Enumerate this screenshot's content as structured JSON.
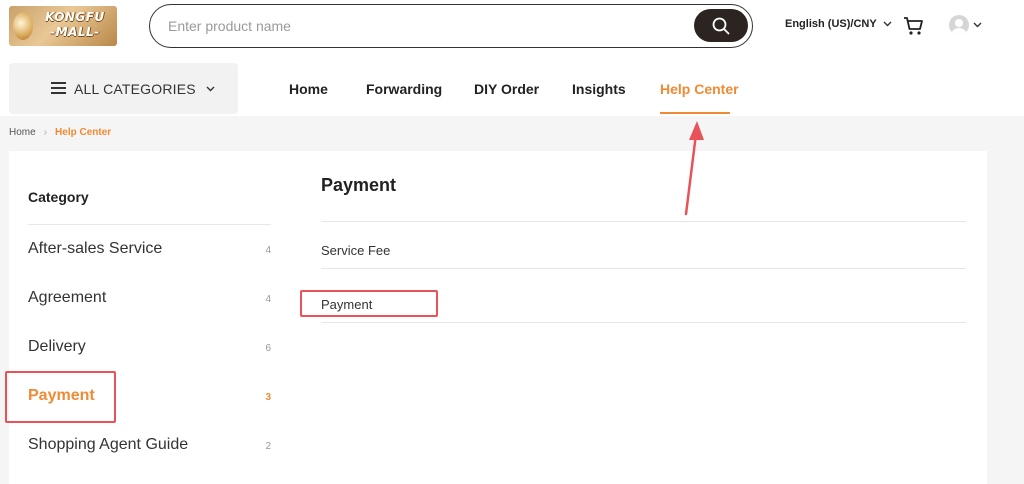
{
  "brand": {
    "logo_text_line1": "KONGFU",
    "logo_text_line2": "-MALL-"
  },
  "search": {
    "placeholder": "Enter product name"
  },
  "header": {
    "language_currency": "English (US)/CNY"
  },
  "categories_button": {
    "label": "ALL CATEGORIES"
  },
  "nav": {
    "items": [
      {
        "label": "Home"
      },
      {
        "label": "Forwarding"
      },
      {
        "label": "DIY Order"
      },
      {
        "label": "Insights"
      },
      {
        "label": "Help Center"
      }
    ],
    "active": "Help Center"
  },
  "breadcrumb": {
    "home": "Home",
    "current": "Help Center"
  },
  "sidebar": {
    "title": "Category",
    "items": [
      {
        "label": "After-sales Service",
        "count": "4"
      },
      {
        "label": "Agreement",
        "count": "4"
      },
      {
        "label": "Delivery",
        "count": "6"
      },
      {
        "label": "Payment",
        "count": "3"
      },
      {
        "label": "Shopping Agent Guide",
        "count": "2"
      }
    ],
    "active": "Payment"
  },
  "content": {
    "title": "Payment",
    "articles": [
      {
        "label": "Service Fee"
      },
      {
        "label": "Payment"
      }
    ]
  },
  "colors": {
    "accent": "#f08a34",
    "annotation": "#e8535a",
    "search_button": "#2b2420"
  }
}
